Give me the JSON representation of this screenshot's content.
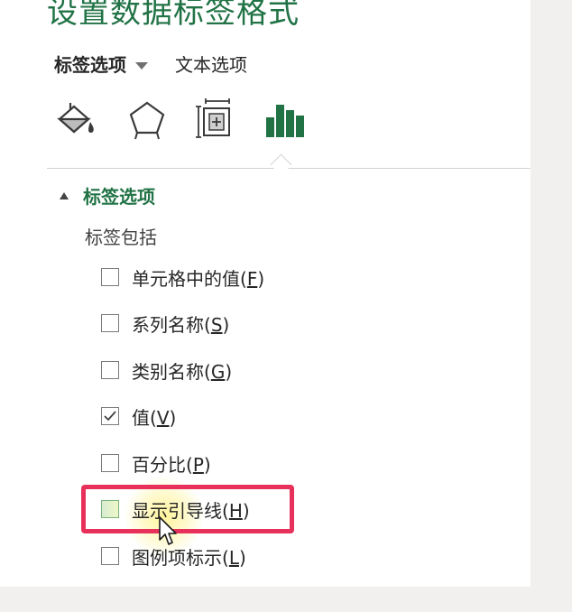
{
  "pane": {
    "title": "设置数据标签格式"
  },
  "tabs": [
    {
      "label": "标签选项",
      "active": true
    },
    {
      "label": "文本选项",
      "active": false
    }
  ],
  "icons": [
    "fill-line-icon",
    "effects-pentagon-icon",
    "size-properties-icon",
    "label-options-bar-chart-icon"
  ],
  "section": {
    "title": "标签选项",
    "group_label": "标签包括",
    "options": [
      {
        "label": "单元格中的值",
        "key": "F",
        "checked": false
      },
      {
        "label": "系列名称",
        "key": "S",
        "checked": false
      },
      {
        "label": "类别名称",
        "key": "G",
        "checked": false
      },
      {
        "label": "值",
        "key": "V",
        "checked": true
      },
      {
        "label": "百分比",
        "key": "P",
        "checked": false
      },
      {
        "label": "显示引导线",
        "key": "H",
        "checked": false
      },
      {
        "label": "图例项标示",
        "key": "L",
        "checked": false
      }
    ]
  },
  "colors": {
    "accent": "#217346",
    "highlight": "#e8315a"
  }
}
